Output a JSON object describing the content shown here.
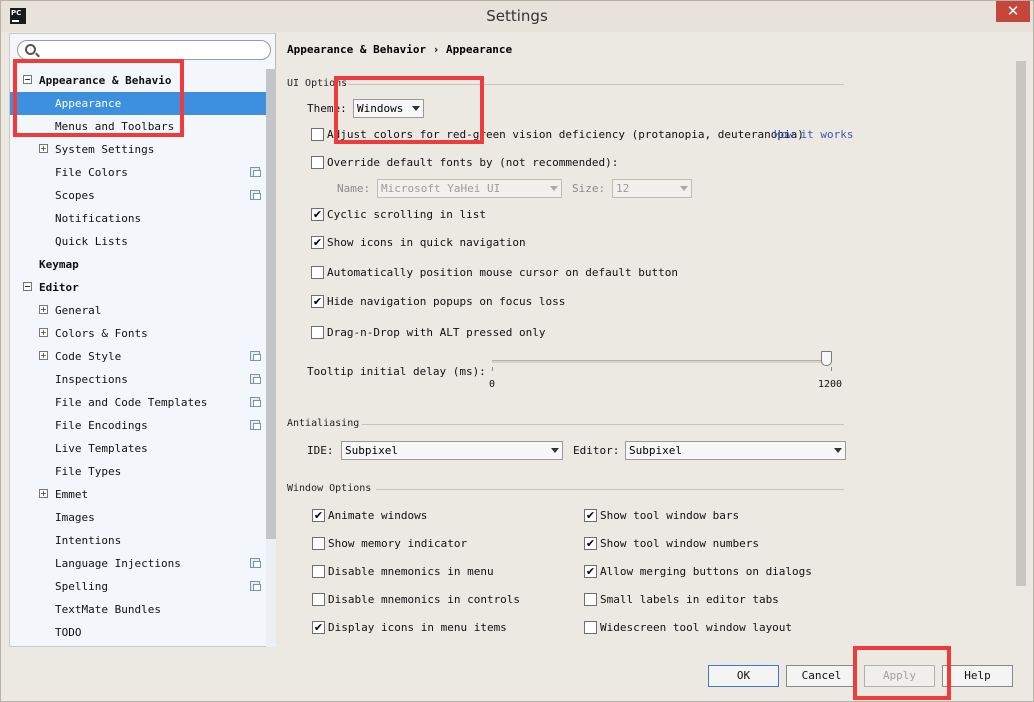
{
  "window": {
    "title": "Settings",
    "app_icon_label": "PC",
    "close_label": "✕"
  },
  "search": {
    "placeholder": ""
  },
  "tree": [
    {
      "label": "Appearance & Behavior",
      "visible_label": "Appearance & Behavio",
      "expander": "−"
    },
    {
      "label": "Appearance"
    },
    {
      "label": "Menus and Toolbars"
    },
    {
      "label": "System Settings",
      "expander": "+"
    },
    {
      "label": "File Colors"
    },
    {
      "label": "Scopes"
    },
    {
      "label": "Notifications"
    },
    {
      "label": "Quick Lists"
    },
    {
      "label": "Keymap"
    },
    {
      "label": "Editor",
      "expander": "−"
    },
    {
      "label": "General",
      "expander": "+"
    },
    {
      "label": "Colors & Fonts",
      "expander": "+"
    },
    {
      "label": "Code Style",
      "expander": "+"
    },
    {
      "label": "Inspections"
    },
    {
      "label": "File and Code Templates"
    },
    {
      "label": "File Encodings"
    },
    {
      "label": "Live Templates"
    },
    {
      "label": "File Types"
    },
    {
      "label": "Emmet",
      "expander": "+"
    },
    {
      "label": "Images"
    },
    {
      "label": "Intentions"
    },
    {
      "label": "Language Injections"
    },
    {
      "label": "Spelling"
    },
    {
      "label": "TextMate Bundles"
    },
    {
      "label": "TODO"
    }
  ],
  "breadcrumb": {
    "parent": "Appearance & Behavior",
    "separator": "›",
    "current": "Appearance"
  },
  "ui_options": {
    "section": "UI Options",
    "theme_label": "Theme:",
    "theme_value": "Windows",
    "adjust_colors": {
      "label": "Adjust colors for red-green vision deficiency (protanopia, deuteranopia)",
      "checked": false,
      "link": "How it works"
    },
    "override_fonts": {
      "label": "Override default fonts by (not recommended):",
      "checked": false
    },
    "name_label": "Name:",
    "name_value": "Microsoft YaHei UI",
    "size_label": "Size:",
    "size_value": "12",
    "cyclic_scrolling": {
      "label": "Cyclic scrolling in list",
      "checked": true
    },
    "show_icons": {
      "label": "Show icons in quick navigation",
      "checked": true
    },
    "auto_position": {
      "label": "Automatically position mouse cursor on default button",
      "checked": false
    },
    "hide_popups": {
      "label": "Hide navigation popups on focus loss",
      "checked": true
    },
    "drag_drop": {
      "label": "Drag-n-Drop with ALT pressed only",
      "checked": false
    },
    "tooltip_label": "Tooltip initial delay (ms):",
    "tooltip_min": "0",
    "tooltip_max": "1200",
    "tooltip_value_fraction": 1.0
  },
  "antialiasing": {
    "section": "Antialiasing",
    "ide_label": "IDE:",
    "ide_value": "Subpixel",
    "editor_label": "Editor:",
    "editor_value": "Subpixel"
  },
  "window_options": {
    "section": "Window Options",
    "left": [
      {
        "label": "Animate windows",
        "checked": true
      },
      {
        "label": "Show memory indicator",
        "checked": false
      },
      {
        "label": "Disable mnemonics in menu",
        "checked": false
      },
      {
        "label": "Disable mnemonics in controls",
        "checked": false
      },
      {
        "label": "Display icons in menu items",
        "checked": true
      }
    ],
    "right": [
      {
        "label": "Show tool window bars",
        "checked": true
      },
      {
        "label": "Show tool window numbers",
        "checked": true
      },
      {
        "label": "Allow merging buttons on dialogs",
        "checked": true
      },
      {
        "label": "Small labels in editor tabs",
        "checked": false
      },
      {
        "label": "Widescreen tool window layout",
        "checked": false
      }
    ]
  },
  "buttons": {
    "ok": "OK",
    "cancel": "Cancel",
    "apply": "Apply",
    "help": "Help"
  },
  "colors": {
    "selection": "#3d8fe0",
    "highlight_box": "#ef3b3b",
    "link": "#3a57b7"
  }
}
